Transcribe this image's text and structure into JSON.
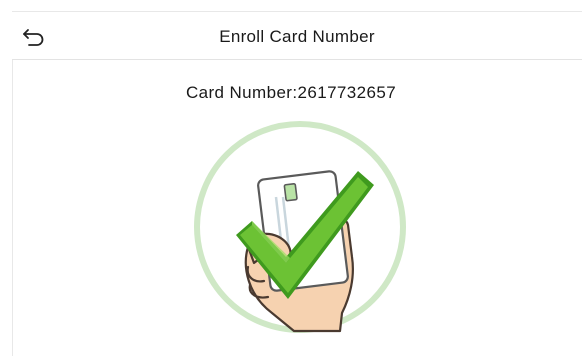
{
  "header": {
    "title": "Enroll Card Number",
    "back_icon": "back-arrow-icon"
  },
  "main": {
    "card_number_label": "Card Number:",
    "card_number_value": "2617732657",
    "illustration_icon": "card-verified-check-icon"
  },
  "colors": {
    "ring": "#c8e6c0",
    "check_green": "#6cc234",
    "check_green_dark": "#3f9a1e",
    "skin": "#f5d3b3",
    "skin_outline": "#4a3a30",
    "card": "#ffffff",
    "card_outline": "#5a5a5a"
  }
}
